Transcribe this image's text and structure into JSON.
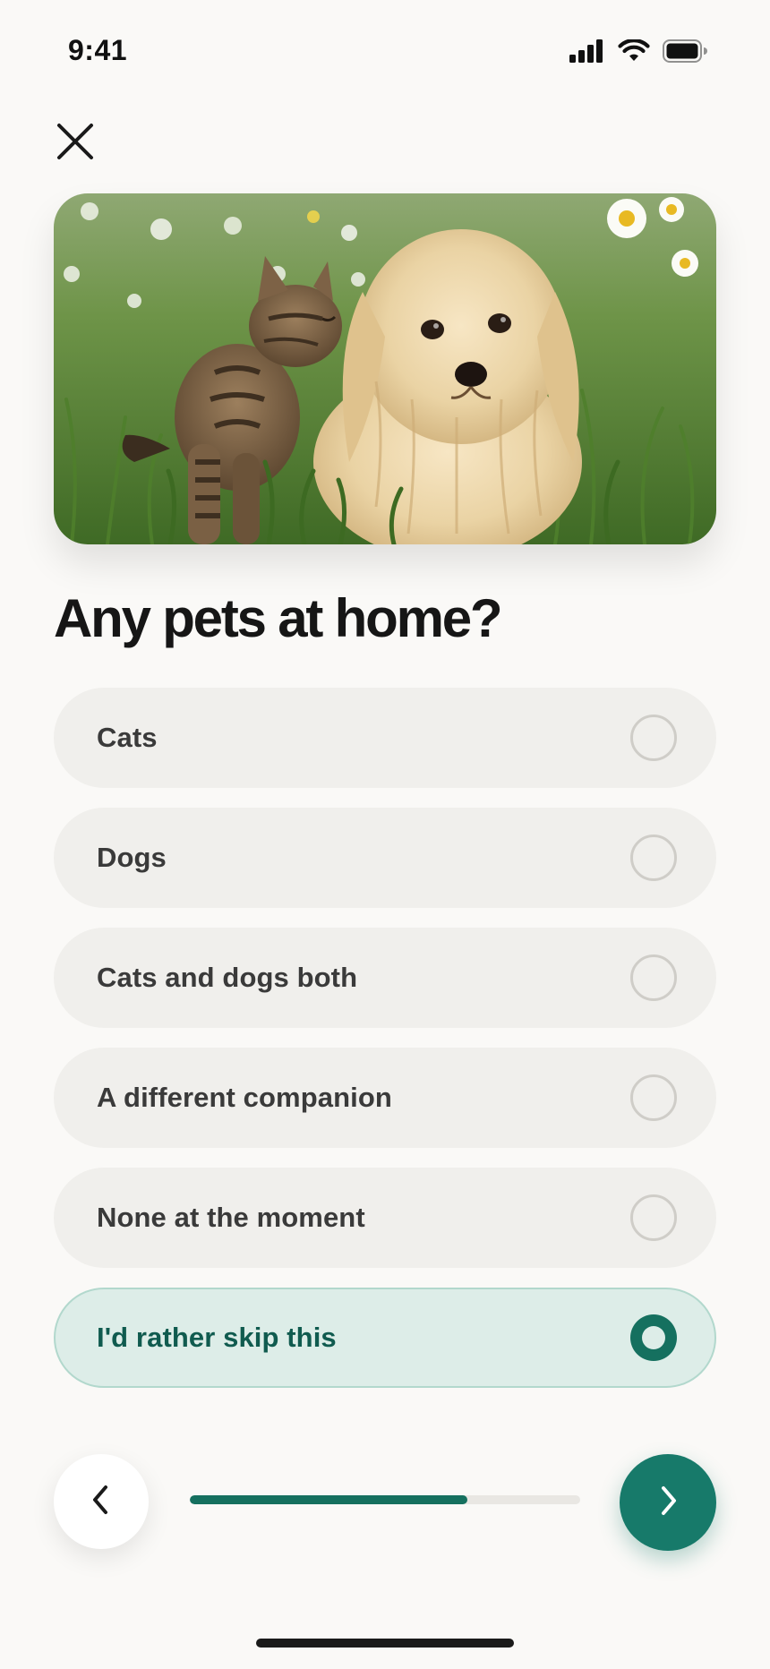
{
  "status_bar": {
    "time": "9:41",
    "icons": [
      "cellular-signal-icon",
      "wifi-icon",
      "battery-icon"
    ]
  },
  "header": {
    "close_icon": "close-icon"
  },
  "hero_image": {
    "alt": "Cat and dog sitting together in grass",
    "icon": "hero-photo"
  },
  "question": {
    "title": "Any pets at home?"
  },
  "options": [
    {
      "label": "Cats",
      "selected": false
    },
    {
      "label": "Dogs",
      "selected": false
    },
    {
      "label": "Cats and dogs both",
      "selected": false
    },
    {
      "label": "A different companion",
      "selected": false
    },
    {
      "label": "None at the moment",
      "selected": false
    },
    {
      "label": "I'd rather skip this",
      "selected": true
    }
  ],
  "navigation": {
    "back_icon": "chevron-left-icon",
    "next_icon": "chevron-right-icon",
    "progress_fraction": 0.71
  },
  "colors": {
    "accent": "#177a6a",
    "accent_dark": "#105b4f",
    "selected_bg": "#ddede8",
    "option_bg": "#f0efec",
    "page_bg": "#faf9f7"
  }
}
